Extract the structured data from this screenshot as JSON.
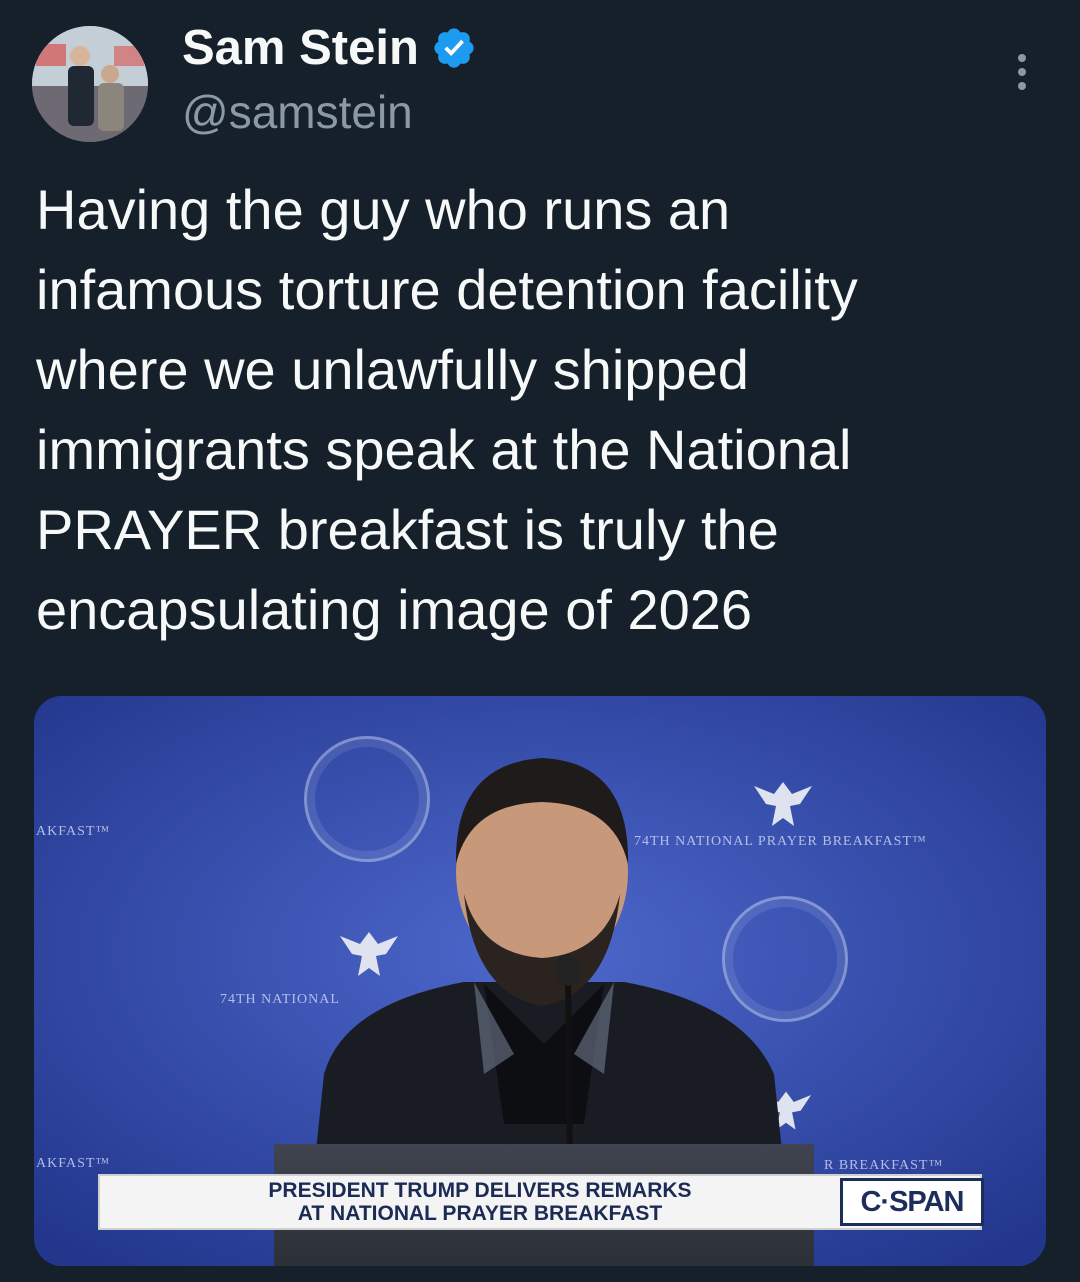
{
  "author": {
    "display_name": "Sam Stein",
    "handle": "@samstein",
    "verified_color": "#1d9bf0"
  },
  "tweet": {
    "text": "Having the guy who runs an\ninfamous torture detention facility\nwhere we unlawfully shipped\nimmigrants speak at the National\nPRAYER breakfast is truly the\nencapsulating image of 2026"
  },
  "media": {
    "backdrop_center": "74TH NATIONAL PRAYER BREAKFAST™",
    "backdrop_left_top": "AKFAST™",
    "backdrop_left_mid": "74TH NATIONAL",
    "backdrop_left_bottom": "AKFAST™",
    "backdrop_right_bottom": "R BREAKFAST™",
    "caption": "PRESIDENT TRUMP DELIVERS REMARKS\nAT NATIONAL PRAYER BREAKFAST",
    "network_logo": "C·SPAN"
  },
  "icons": [
    "verified-badge-icon",
    "more-options-icon"
  ]
}
